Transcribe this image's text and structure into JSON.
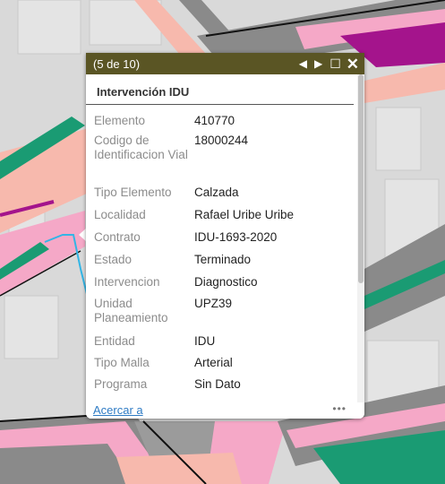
{
  "colors": {
    "header_bg": "#5a5524",
    "link": "#2e7bc4",
    "label": "#8c8c8c",
    "map_road_pink": "#f5a8c7",
    "map_road_salmon": "#f7b9ad",
    "map_road_green": "#1a9b73",
    "map_road_magenta": "#a4148c",
    "map_road_gray": "#8a8a8a"
  },
  "popup": {
    "counter": "(5 de 10)",
    "title": "Intervención IDU",
    "icons": {
      "prev": "triangle-left-icon",
      "next": "triangle-right-icon",
      "maximize": "maximize-icon",
      "close": "close-icon",
      "more": "ellipsis-icon"
    },
    "attributes": [
      {
        "label": "Elemento",
        "value": "410770"
      },
      {
        "label": "Codigo de Identificacion Vial",
        "value": "18000244"
      },
      {
        "label": "Tipo Elemento",
        "value": "Calzada"
      },
      {
        "label": "Localidad",
        "value": "Rafael Uribe Uribe"
      },
      {
        "label": "Contrato",
        "value": "IDU-1693-2020"
      },
      {
        "label": "Estado",
        "value": "Terminado"
      },
      {
        "label": "Intervencion",
        "value": "Diagnostico"
      },
      {
        "label": "Unidad Planeamiento",
        "value": "UPZ39"
      },
      {
        "label": "Entidad",
        "value": "IDU"
      },
      {
        "label": "Tipo Malla",
        "value": "Arterial"
      },
      {
        "label": "Programa",
        "value": "Sin Dato"
      }
    ],
    "zoom_label": "Acercar a",
    "more_label": "•••"
  }
}
